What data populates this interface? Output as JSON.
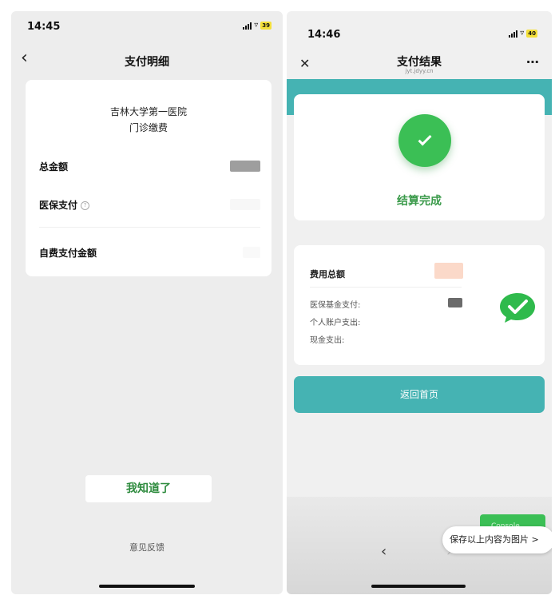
{
  "left": {
    "status": {
      "time": "14:45",
      "battery": "39"
    },
    "nav": {
      "back_icon": "chevron-left-icon",
      "title": "支付明细"
    },
    "hospital": {
      "name": "吉林大学第一医院",
      "category": "门诊缴费"
    },
    "rows": {
      "total": "总金额",
      "insurance": "医保支付",
      "insurance_info_icon": "question-circle-icon",
      "self_pay": "自费支付金额"
    },
    "button": "我知道了",
    "feedback": "意见反馈"
  },
  "right": {
    "status": {
      "time": "14:46",
      "battery": "40"
    },
    "nav": {
      "close_icon": "close-icon",
      "title": "支付结果",
      "subtitle": "jyt.jdyy.cn",
      "more_icon": "more-dots-icon"
    },
    "result": {
      "icon": "check-circle-icon",
      "text": "结算完成"
    },
    "fees": {
      "total_label": "费用总额",
      "insurance_fund": "医保基金支付:",
      "personal_account": "个人账户支出:",
      "cash": "现金支出:",
      "wechat_icon": "wechat-pay-icon"
    },
    "home_button": "返回首页",
    "toolbar": {
      "back_icon": "chevron-left-icon",
      "forward_icon": "chevron-right-icon"
    },
    "green_chip": "Console",
    "save_prompt": "保存以上内容为图片 >"
  },
  "colors": {
    "teal": "#45b3b3",
    "green": "#3bbf55",
    "text_green": "#2e8b3e"
  }
}
